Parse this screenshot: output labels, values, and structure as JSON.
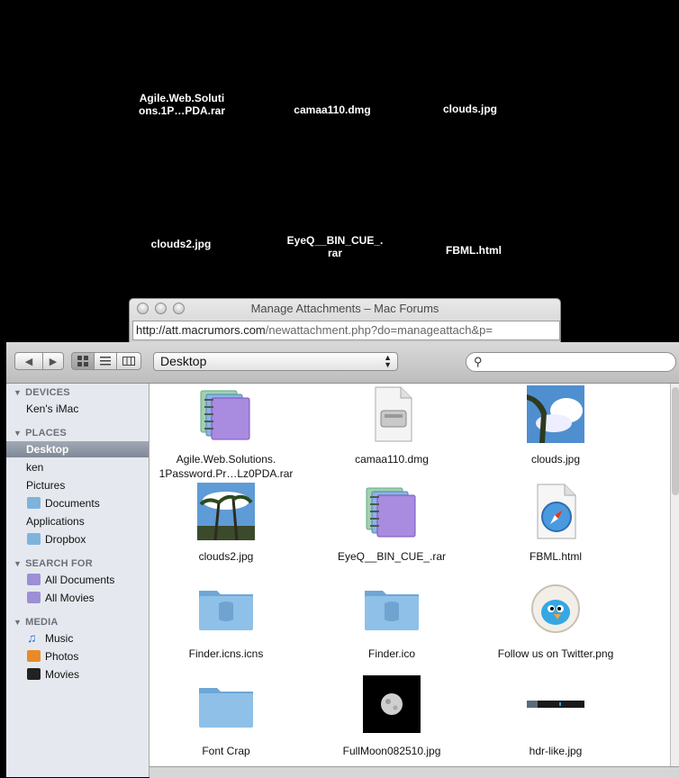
{
  "desktop": {
    "icons": [
      {
        "label": "Agile.Web.Soluti\nons.1P…PDA.rar"
      },
      {
        "label": "camaa110.dmg"
      },
      {
        "label": "clouds.jpg"
      },
      {
        "label": "clouds2.jpg"
      },
      {
        "label": "EyeQ__BIN_CUE_.\nrar"
      },
      {
        "label": "FBML.html"
      }
    ]
  },
  "browser": {
    "title": "Manage Attachments – Mac Forums",
    "url_host": "http://att.macrumors.com",
    "url_path": "/newattachment.php?do=manageattach&p="
  },
  "finder": {
    "location": "Desktop",
    "search_placeholder": "",
    "sidebar": {
      "devices_header": "DEVICES",
      "devices": [
        "Ken's iMac"
      ],
      "places_header": "PLACES",
      "places": [
        "Desktop",
        "ken",
        "Pictures",
        "Documents",
        "Applications",
        "Dropbox"
      ],
      "search_header": "SEARCH FOR",
      "searches": [
        "All Documents",
        "All Movies"
      ],
      "media_header": "MEDIA",
      "media": [
        "Music",
        "Photos",
        "Movies"
      ]
    },
    "files": [
      {
        "name": "Agile.Web.Solutions.\n1Password.Pr…Lz0PDA.rar",
        "icon": "rar-archive-icon"
      },
      {
        "name": "camaa110.dmg",
        "icon": "disk-image-icon"
      },
      {
        "name": "clouds.jpg",
        "icon": "photo-thumbnail"
      },
      {
        "name": "clouds2.jpg",
        "icon": "photo-thumbnail"
      },
      {
        "name": "EyeQ__BIN_CUE_.rar",
        "icon": "rar-archive-icon"
      },
      {
        "name": "FBML.html",
        "icon": "safari-html-icon"
      },
      {
        "name": "Finder.icns.icns",
        "icon": "folder-icon"
      },
      {
        "name": "Finder.ico",
        "icon": "folder-icon"
      },
      {
        "name": "Follow us on Twitter.png",
        "icon": "twitter-bird-icon"
      },
      {
        "name": "Font Crap",
        "icon": "folder-icon"
      },
      {
        "name": "FullMoon082510.jpg",
        "icon": "moon-photo-thumbnail"
      },
      {
        "name": "hdr-like.jpg",
        "icon": "hdr-photo-thumbnail"
      }
    ]
  },
  "colors": {
    "desktop_bg": "#000000",
    "sidebar_bg": "#e5e9ef",
    "selection": "#8a93a1",
    "folder_blue": "#7fb3dc"
  }
}
